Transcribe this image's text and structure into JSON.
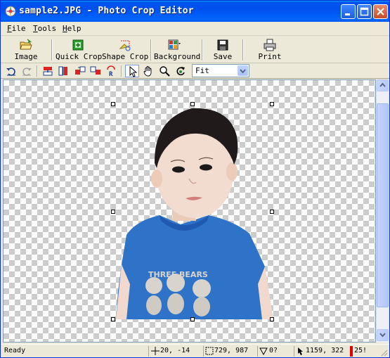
{
  "window": {
    "title": "sample2.JPG - Photo Crop Editor"
  },
  "menu": {
    "file_hot": "F",
    "file_rest": "ile",
    "tools_hot": "T",
    "tools_rest": "ools",
    "help_hot": "H",
    "help_rest": "elp"
  },
  "toolbar": {
    "image": "Image",
    "quick_crop": "Quick Crop",
    "shape_crop": "Shape Crop",
    "background": "Background",
    "save": "Save",
    "print": "Print"
  },
  "zoom": {
    "value": "Fit"
  },
  "photo": {
    "shirt_text": "THREE BEARS"
  },
  "status": {
    "ready": "Ready",
    "position": "20, -14",
    "size": "729, 987",
    "angle": "0?",
    "cursor": "1159, 322",
    "extra": "25!"
  },
  "colors": {
    "title_bar": "#0054e3",
    "shirt": "#2f73c8",
    "skin": "#efd2c0",
    "hair": "#1e1a19"
  },
  "icons": [
    "app-icon",
    "minimize-icon",
    "maximize-icon",
    "close-icon",
    "open-image-icon",
    "quick-crop-icon",
    "shape-crop-icon",
    "background-icon",
    "save-icon",
    "print-icon",
    "rotate-left-icon",
    "rotate-right-icon",
    "flip-horizontal-icon",
    "flip-vertical-icon",
    "move-left-icon",
    "move-right-icon",
    "reset-icon",
    "pointer-icon",
    "hand-icon",
    "magnifier-icon",
    "refresh-icon",
    "dropdown-arrow-icon"
  ]
}
